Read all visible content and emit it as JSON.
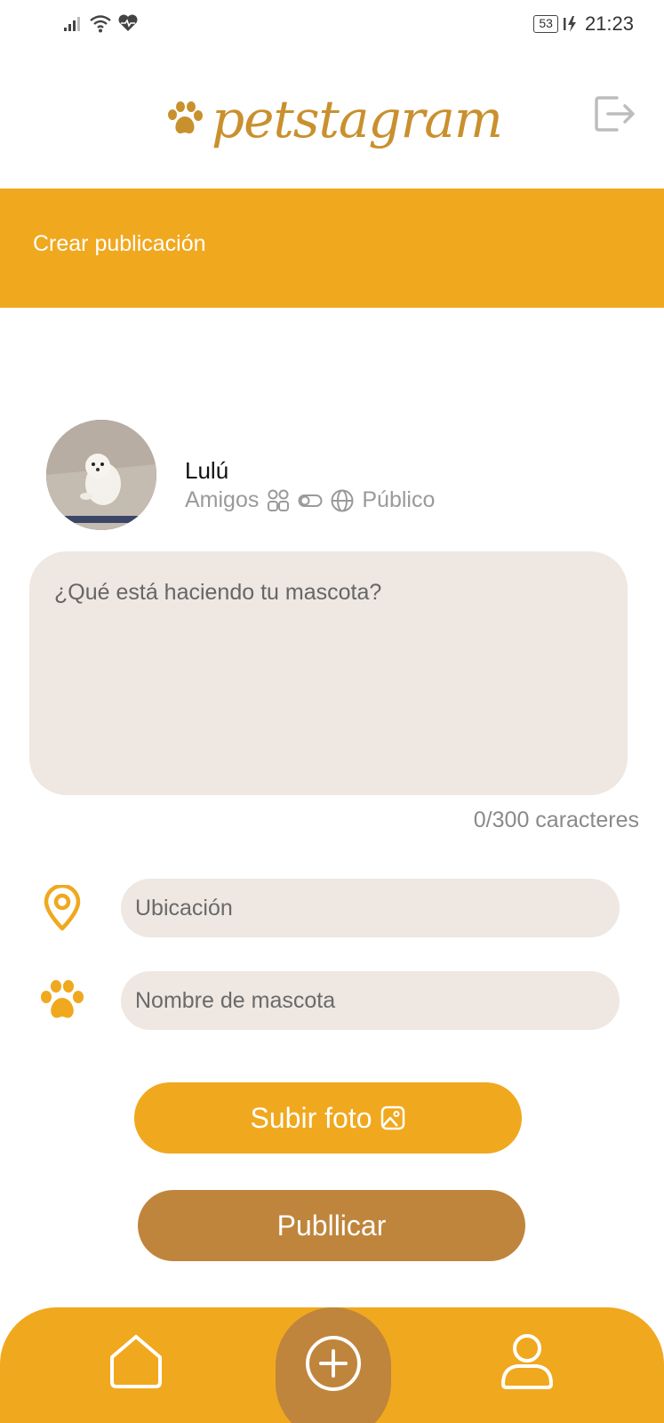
{
  "status_bar": {
    "battery": "53",
    "time": "21:23",
    "icons": [
      "signal-icon",
      "wifi-icon",
      "heart-health-icon",
      "battery-icon",
      "charging-icon"
    ]
  },
  "header": {
    "logo_text": "petstagram",
    "logo_icon": "paw-icon",
    "logout_icon": "logout-icon"
  },
  "page": {
    "title": "Crear publicación"
  },
  "profile": {
    "name": "Lulú",
    "privacy_friends": "Amigos",
    "privacy_public": "Público"
  },
  "post": {
    "placeholder": "¿Qué está haciendo tu mascota?",
    "counter": "0/300 caracteres"
  },
  "fields": {
    "location_placeholder": "Ubicación",
    "pet_name_placeholder": "Nombre de mascota"
  },
  "actions": {
    "upload_label": "Subir foto",
    "publish_label": "Publlicar"
  },
  "nav": {
    "items": [
      "home-icon",
      "add-icon",
      "profile-icon"
    ]
  },
  "colors": {
    "accent": "#F0A81E",
    "brown": "#BF853C",
    "input_bg": "#EEE7E2"
  }
}
